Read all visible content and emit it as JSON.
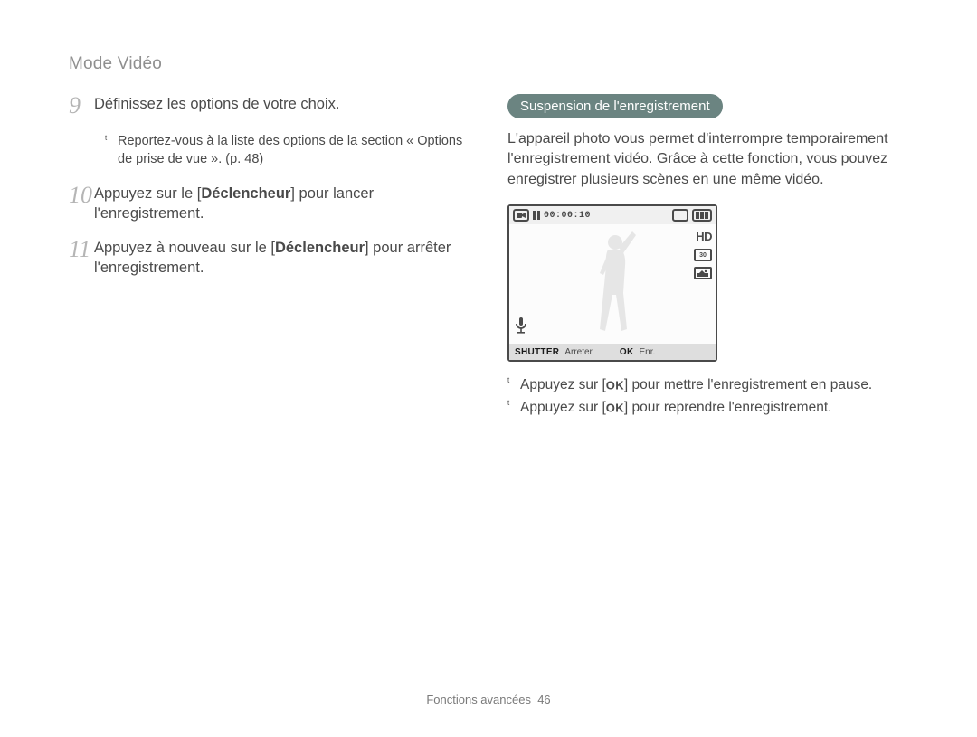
{
  "header": {
    "title": "Mode Vidéo"
  },
  "left": {
    "steps": [
      {
        "num": "9",
        "text_before": "Définissez les options de votre choix.",
        "bold": "",
        "text_after": "",
        "sub": [
          "Reportez-vous à la liste des options de la section « Options de prise de vue ». (p. 48)"
        ]
      },
      {
        "num": "10",
        "text_before": "Appuyez sur le [",
        "bold": "Déclencheur",
        "text_after": "] pour lancer l'enregistrement."
      },
      {
        "num": "11",
        "text_before": "Appuyez à nouveau sur le [",
        "bold": "Déclencheur",
        "text_after": "] pour arrêter l'enregistrement."
      }
    ]
  },
  "right": {
    "pill": "Suspension de l'enregistrement",
    "paragraph": "L'appareil photo vous permet d'interrompre temporairement l'enregistrement vidéo. Grâce à cette fonction, vous pouvez enregistrer plusieurs scènes en une même vidéo.",
    "lcd": {
      "time": "00:00:10",
      "pause_icon": "videocam",
      "hd_label": "HD",
      "fps_label": "30",
      "shutter_label": "SHUTTER",
      "shutter_text": "Arreter",
      "ok_label": "OK",
      "ok_text": "Enr."
    },
    "bullets": [
      {
        "before": "Appuyez sur [",
        "ok": "OK",
        "after": "] pour mettre l'enregistrement en pause."
      },
      {
        "before": "Appuyez sur [",
        "ok": "OK",
        "after": "] pour reprendre l'enregistrement."
      }
    ]
  },
  "footer": {
    "section": "Fonctions avancées",
    "page_num": "46"
  }
}
